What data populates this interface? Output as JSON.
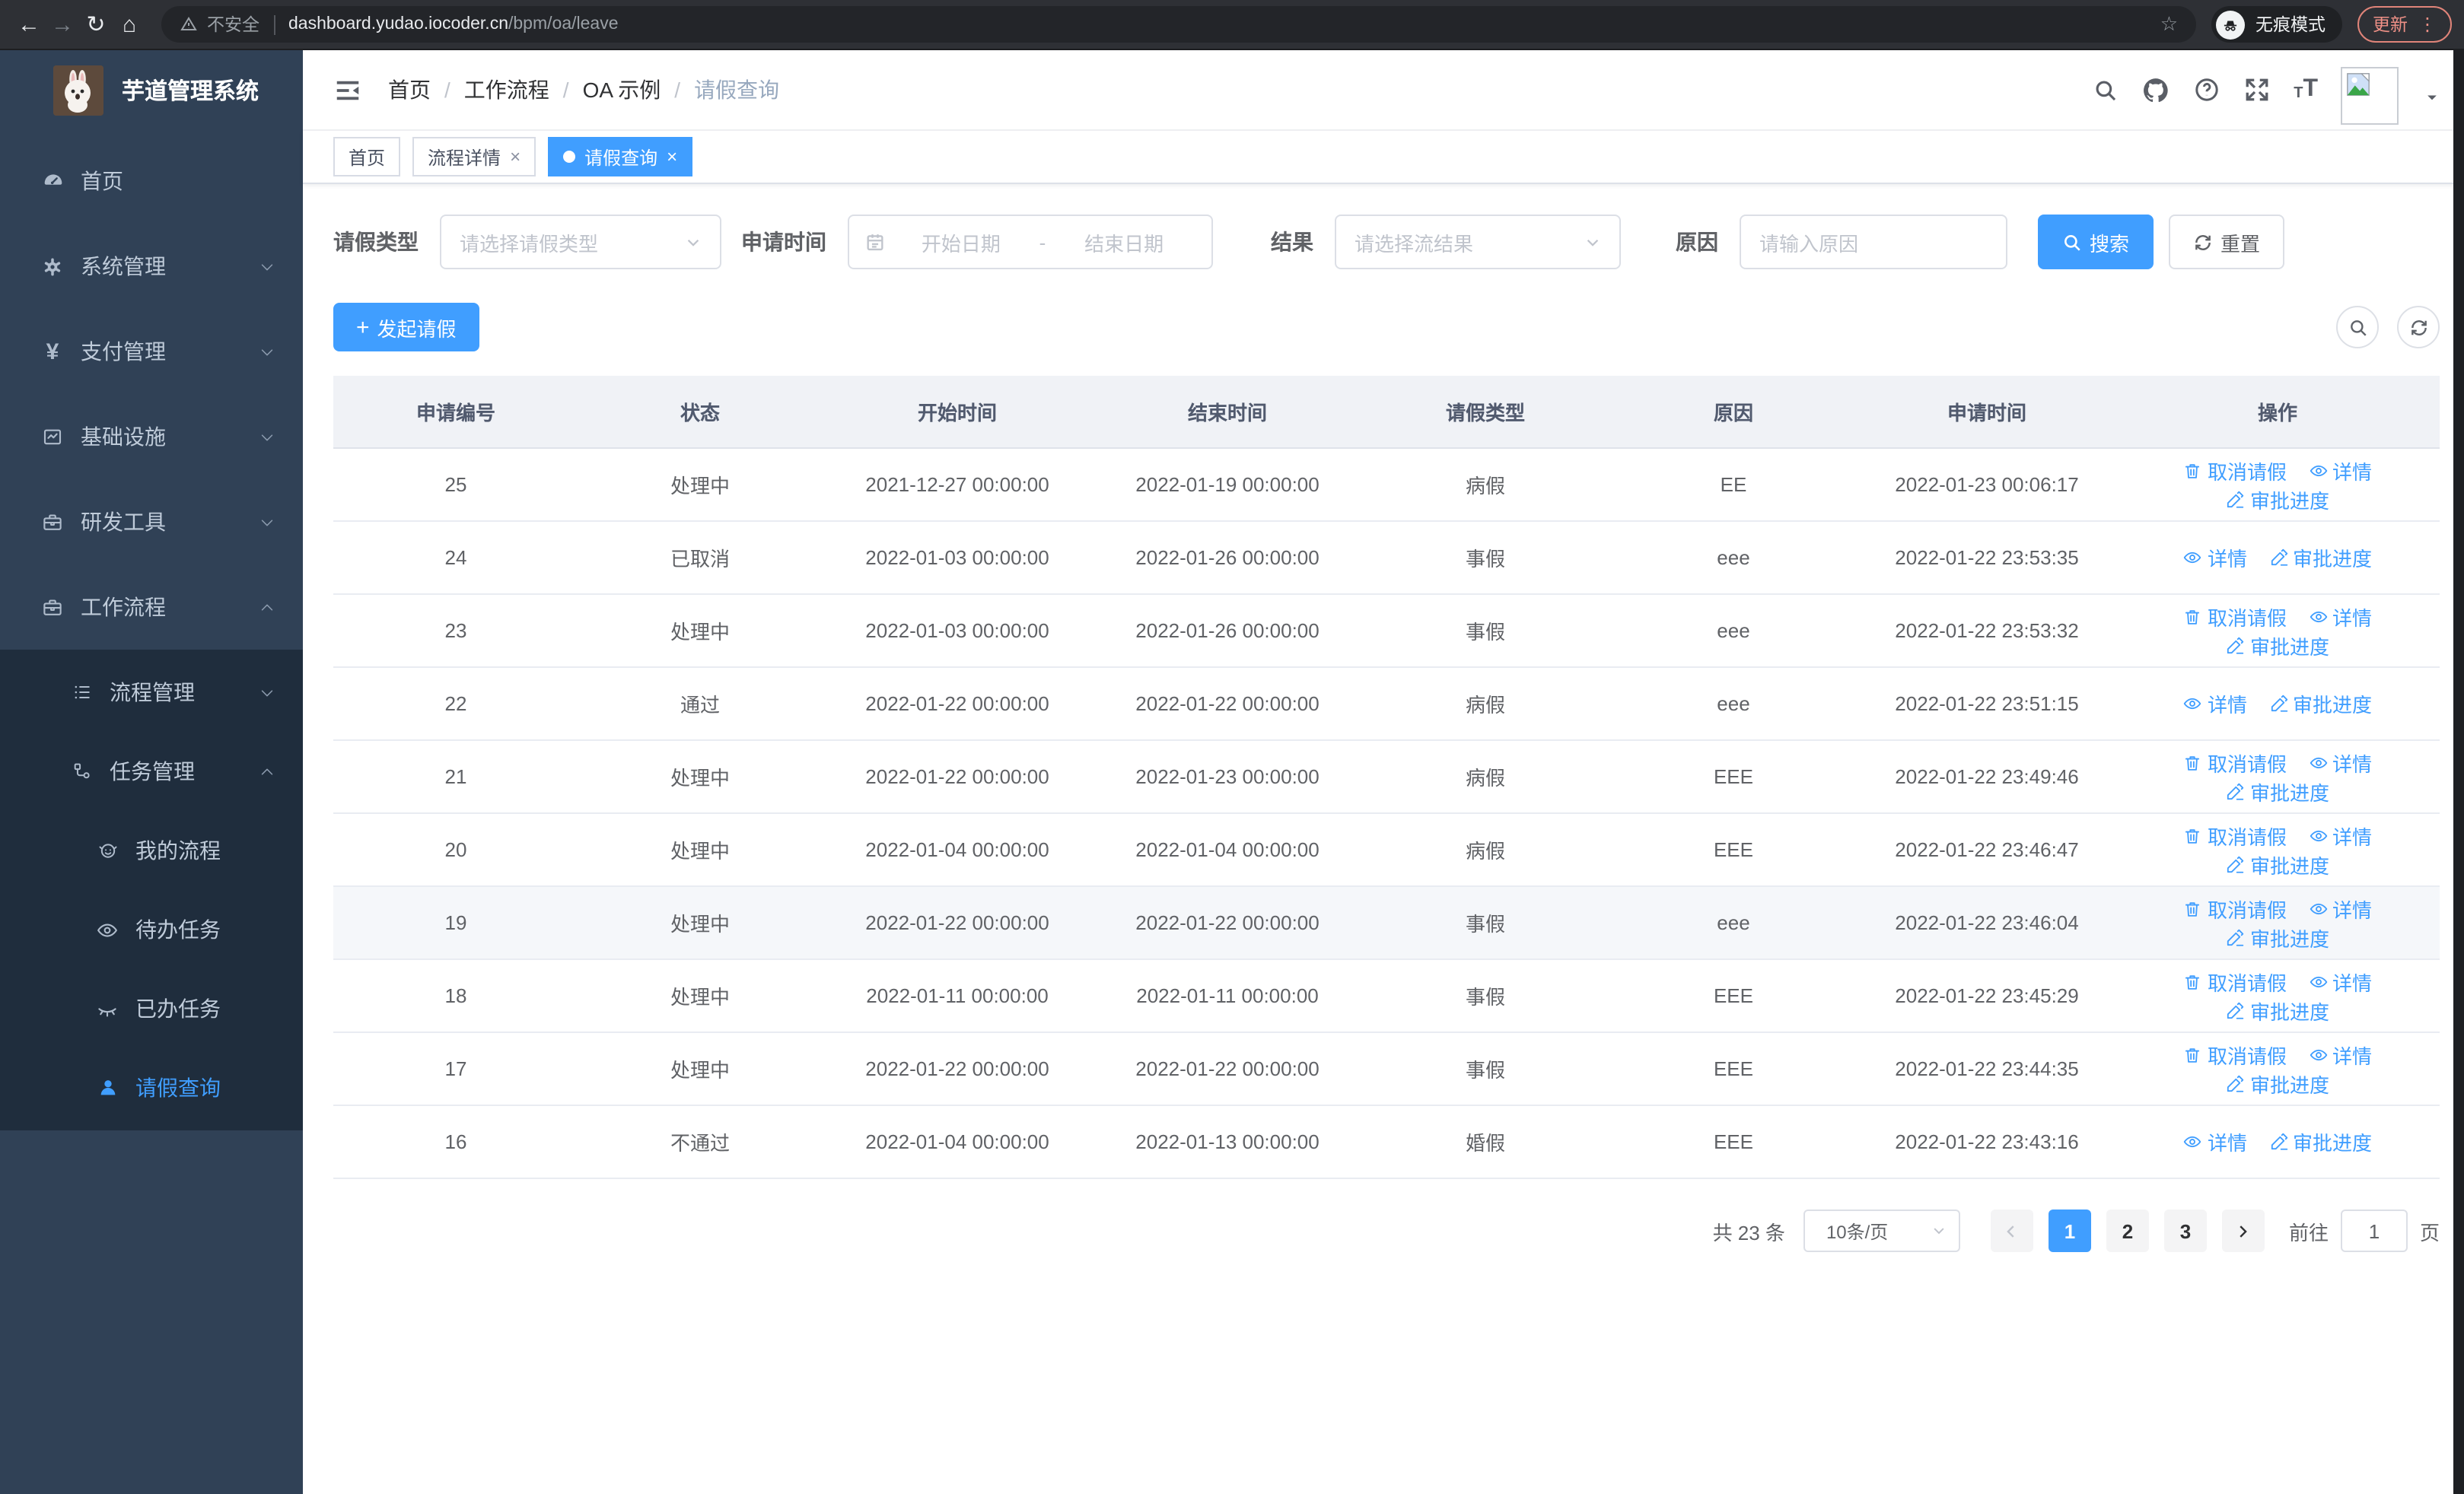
{
  "browser": {
    "security_label": "不安全",
    "url_host": "dashboard.yudao.iocoder.cn",
    "url_path": "/bpm/oa/leave",
    "incognito_label": "无痕模式",
    "update_label": "更新"
  },
  "sidebar": {
    "title": "芋道管理系统",
    "menu": [
      {
        "name": "home",
        "label": "首页",
        "icon": "gauge",
        "level": 1,
        "group": "root",
        "arrow": null,
        "active": false
      },
      {
        "name": "system-management",
        "label": "系统管理",
        "icon": "gear",
        "level": 1,
        "group": "root",
        "arrow": "down",
        "active": false
      },
      {
        "name": "payment-management",
        "label": "支付管理",
        "icon": "yen",
        "level": 1,
        "group": "root",
        "arrow": "down",
        "active": false
      },
      {
        "name": "infrastructure",
        "label": "基础设施",
        "icon": "infra",
        "level": 1,
        "group": "root",
        "arrow": "down",
        "active": false
      },
      {
        "name": "dev-tools",
        "label": "研发工具",
        "icon": "toolbox",
        "level": 1,
        "group": "root",
        "arrow": "down",
        "active": false
      },
      {
        "name": "workflow",
        "label": "工作流程",
        "icon": "toolbox",
        "level": 1,
        "group": "root",
        "arrow": "up",
        "active": false
      },
      {
        "name": "process-management",
        "label": "流程管理",
        "icon": "list",
        "level": 2,
        "group": "sub",
        "arrow": "down",
        "active": false
      },
      {
        "name": "task-management",
        "label": "任务管理",
        "icon": "flow",
        "level": 2,
        "group": "sub",
        "arrow": "up",
        "active": false
      },
      {
        "name": "my-process",
        "label": "我的流程",
        "icon": "face",
        "level": 3,
        "group": "sub",
        "arrow": null,
        "active": false
      },
      {
        "name": "todo-tasks",
        "label": "待办任务",
        "icon": "eye-open",
        "level": 3,
        "group": "sub",
        "arrow": null,
        "active": false
      },
      {
        "name": "done-tasks",
        "label": "已办任务",
        "icon": "eye-closed",
        "level": 3,
        "group": "sub",
        "arrow": null,
        "active": false
      },
      {
        "name": "leave-query",
        "label": "请假查询",
        "icon": "user",
        "level": 3,
        "group": "sub",
        "arrow": null,
        "active": true
      }
    ]
  },
  "header": {
    "breadcrumb": [
      "首页",
      "工作流程",
      "OA 示例",
      "请假查询"
    ],
    "separator": "/"
  },
  "tabs": [
    {
      "name": "tab-home",
      "label": "首页",
      "closable": false,
      "active": false
    },
    {
      "name": "tab-process-detail",
      "label": "流程详情",
      "closable": true,
      "active": false
    },
    {
      "name": "tab-leave-query",
      "label": "请假查询",
      "closable": true,
      "active": true
    }
  ],
  "filters": {
    "leave_type_label": "请假类型",
    "leave_type_placeholder": "请选择请假类型",
    "apply_time_label": "申请时间",
    "date_start_placeholder": "开始日期",
    "date_separator": "-",
    "date_end_placeholder": "结束日期",
    "result_label": "结果",
    "result_placeholder": "请选择流结果",
    "reason_label": "原因",
    "reason_placeholder": "请输入原因",
    "search_label": "搜索",
    "reset_label": "重置"
  },
  "toolbar": {
    "create_label": "发起请假"
  },
  "table": {
    "headers": [
      "申请编号",
      "状态",
      "开始时间",
      "结束时间",
      "请假类型",
      "原因",
      "申请时间",
      "操作"
    ],
    "action_labels": {
      "cancel": "取消请假",
      "detail": "详情",
      "progress": "审批进度"
    },
    "rows": [
      {
        "id": "25",
        "status": "处理中",
        "start": "2021-12-27 00:00:00",
        "end": "2022-01-19 00:00:00",
        "type": "病假",
        "reason": "EE",
        "applied": "2022-01-23 00:06:17",
        "cancel": true,
        "highlight": false
      },
      {
        "id": "24",
        "status": "已取消",
        "start": "2022-01-03 00:00:00",
        "end": "2022-01-26 00:00:00",
        "type": "事假",
        "reason": "eee",
        "applied": "2022-01-22 23:53:35",
        "cancel": false,
        "highlight": false
      },
      {
        "id": "23",
        "status": "处理中",
        "start": "2022-01-03 00:00:00",
        "end": "2022-01-26 00:00:00",
        "type": "事假",
        "reason": "eee",
        "applied": "2022-01-22 23:53:32",
        "cancel": true,
        "highlight": false
      },
      {
        "id": "22",
        "status": "通过",
        "start": "2022-01-22 00:00:00",
        "end": "2022-01-22 00:00:00",
        "type": "病假",
        "reason": "eee",
        "applied": "2022-01-22 23:51:15",
        "cancel": false,
        "highlight": false
      },
      {
        "id": "21",
        "status": "处理中",
        "start": "2022-01-22 00:00:00",
        "end": "2022-01-23 00:00:00",
        "type": "病假",
        "reason": "EEE",
        "applied": "2022-01-22 23:49:46",
        "cancel": true,
        "highlight": false
      },
      {
        "id": "20",
        "status": "处理中",
        "start": "2022-01-04 00:00:00",
        "end": "2022-01-04 00:00:00",
        "type": "病假",
        "reason": "EEE",
        "applied": "2022-01-22 23:46:47",
        "cancel": true,
        "highlight": false
      },
      {
        "id": "19",
        "status": "处理中",
        "start": "2022-01-22 00:00:00",
        "end": "2022-01-22 00:00:00",
        "type": "事假",
        "reason": "eee",
        "applied": "2022-01-22 23:46:04",
        "cancel": true,
        "highlight": true
      },
      {
        "id": "18",
        "status": "处理中",
        "start": "2022-01-11 00:00:00",
        "end": "2022-01-11 00:00:00",
        "type": "事假",
        "reason": "EEE",
        "applied": "2022-01-22 23:45:29",
        "cancel": true,
        "highlight": false
      },
      {
        "id": "17",
        "status": "处理中",
        "start": "2022-01-22 00:00:00",
        "end": "2022-01-22 00:00:00",
        "type": "事假",
        "reason": "EEE",
        "applied": "2022-01-22 23:44:35",
        "cancel": true,
        "highlight": false
      },
      {
        "id": "16",
        "status": "不通过",
        "start": "2022-01-04 00:00:00",
        "end": "2022-01-13 00:00:00",
        "type": "婚假",
        "reason": "EEE",
        "applied": "2022-01-22 23:43:16",
        "cancel": false,
        "highlight": false
      }
    ]
  },
  "pagination": {
    "total_label": "共 23 条",
    "page_size": "10条/页",
    "pages": [
      "1",
      "2",
      "3"
    ],
    "current": "1",
    "goto_label": "前往",
    "goto_value": "1",
    "unit_label": "页"
  },
  "colors": {
    "primary": "#409eff",
    "sidebar_bg": "#304156",
    "submenu_bg": "#1f2d3d"
  }
}
